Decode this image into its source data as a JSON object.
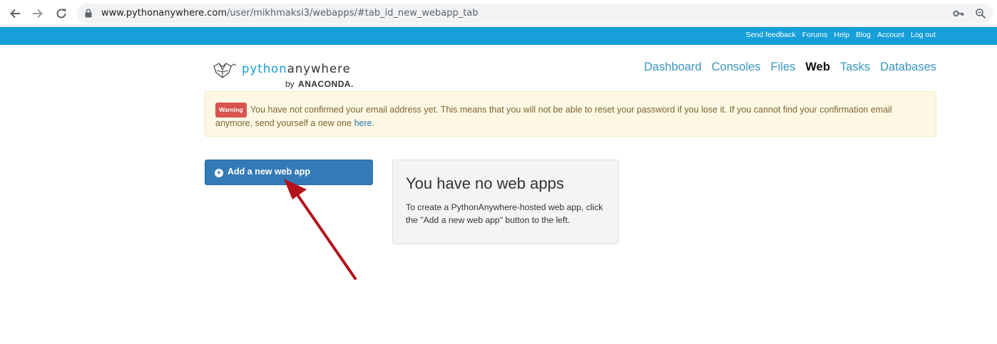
{
  "browser": {
    "url_host": "www.pythonanywhere.com",
    "url_path": "/user/mikhmaksi3/webapps/#tab_id_new_webapp_tab",
    "icons": [
      "back-arrow-icon",
      "forward-arrow-icon",
      "reload-icon",
      "lock-icon",
      "key-icon",
      "zoom-icon"
    ]
  },
  "topbar": {
    "links": [
      "Send feedback",
      "Forums",
      "Help",
      "Blog",
      "Account",
      "Log out"
    ],
    "color": "#179fd9"
  },
  "logo": {
    "word_prefix": "python",
    "word_suffix": "anywhere",
    "by": "by",
    "company": "ANACONDA."
  },
  "nav": {
    "items": [
      "Dashboard",
      "Consoles",
      "Files",
      "Web",
      "Tasks",
      "Databases"
    ],
    "active": "Web"
  },
  "warning": {
    "badge": "Warning",
    "text_before": "You have not confirmed your email address yet. This means that you will not be able to reset your password if you lose it. If you cannot find your confirmation email anymore, send yourself a new one ",
    "link": "here",
    "text_after": "."
  },
  "add_button": {
    "label": "Add a new web app",
    "color": "#337ab7"
  },
  "empty_state": {
    "title": "You have no web apps",
    "body": "To create a PythonAnywhere-hosted web app, click the \"Add a new web app\" button to the left."
  },
  "annotation": {
    "arrow_color": "#b3121a"
  }
}
